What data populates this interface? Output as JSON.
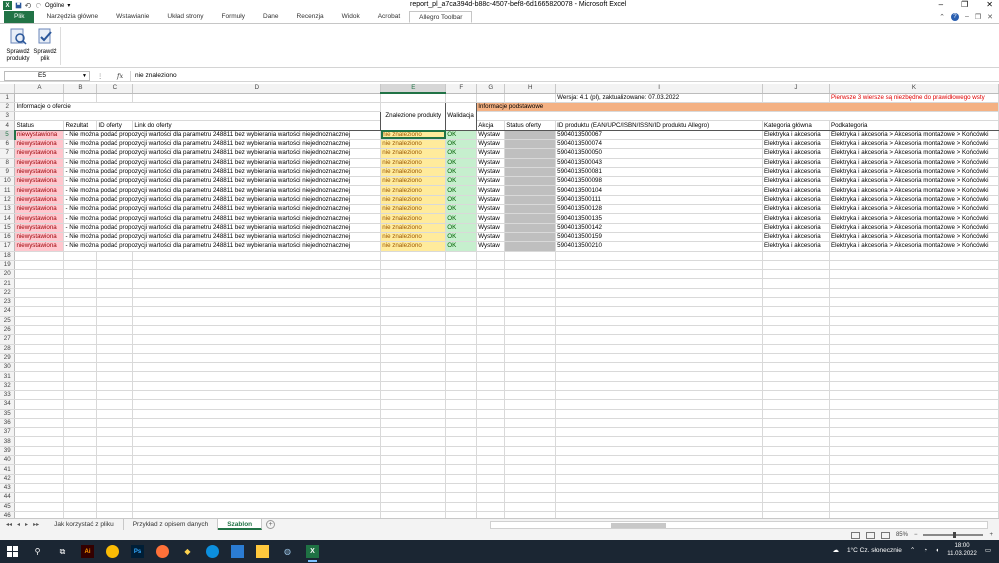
{
  "window": {
    "title": "report_pl_a7ca394d-b88c-4507-bef8-6d1665820078  -  Microsoft Excel",
    "logo": "X",
    "format_box": "Ogólne"
  },
  "ribbon_tabs": [
    "Plik",
    "Narzędzia główne",
    "Wstawianie",
    "Układ strony",
    "Formuły",
    "Dane",
    "Recenzja",
    "Widok",
    "Acrobat",
    "Allegro Toolbar"
  ],
  "ribbon": {
    "btn1": [
      "Sprawdź",
      "produkty"
    ],
    "btn2": [
      "Sprawdź",
      "plik"
    ]
  },
  "formula_bar": {
    "name_box": "E5",
    "fx": "fx",
    "formula": "nie znaleziono"
  },
  "columns": [
    "A",
    "B",
    "C",
    "D",
    "E",
    "F",
    "G",
    "H",
    "I",
    "J",
    "K"
  ],
  "sheet": {
    "version": "Wersja: 4.1 (pl), zaktualizowane: 07.03.2022",
    "note": "Pierwsze 3 wiersze są niezbędne do prawidłowego wsty",
    "info_offer": "Informacje o ofercie",
    "found_products": "Znalezione produkty",
    "validation": "Walidacja",
    "info_basic": "Informacje podstawowe",
    "headers": {
      "status": "Status",
      "result": "Rezultat",
      "offer_id": "ID oferty",
      "link": "Link do oferty",
      "action": "Akcja",
      "offer_status": "Status oferty",
      "product_id": "ID produktu (EAN/UPC/ISBN/ISSN/ID produktu Allegro)",
      "main_cat": "Kategoria główna",
      "subcat": "Podkategoria"
    },
    "rows": [
      {
        "status": "niewystawiona",
        "result": "- Nie można podać propozycji wartości dla parametru 248811 bez wybierania wartości niejednoznacznej",
        "found": "nie znaleziono",
        "valid": "OK",
        "action": "Wystaw",
        "ean": "5904013500067",
        "cat": "Elektryka i akcesoria",
        "sub": "Elektryka i akcesoria > Akcesoria montażowe > Końcówki"
      },
      {
        "status": "niewystawiona",
        "result": "- Nie można podać propozycji wartości dla parametru 248811 bez wybierania wartości niejednoznacznej",
        "found": "nie znaleziono",
        "valid": "OK",
        "action": "Wystaw",
        "ean": "5904013500074",
        "cat": "Elektryka i akcesoria",
        "sub": "Elektryka i akcesoria > Akcesoria montażowe > Końcówki"
      },
      {
        "status": "niewystawiona",
        "result": "- Nie można podać propozycji wartości dla parametru 248811 bez wybierania wartości niejednoznacznej",
        "found": "nie znaleziono",
        "valid": "OK",
        "action": "Wystaw",
        "ean": "5904013500050",
        "cat": "Elektryka i akcesoria",
        "sub": "Elektryka i akcesoria > Akcesoria montażowe > Końcówki"
      },
      {
        "status": "niewystawiona",
        "result": "- Nie można podać propozycji wartości dla parametru 248811 bez wybierania wartości niejednoznacznej",
        "found": "nie znaleziono",
        "valid": "OK",
        "action": "Wystaw",
        "ean": "5904013500043",
        "cat": "Elektryka i akcesoria",
        "sub": "Elektryka i akcesoria > Akcesoria montażowe > Końcówki"
      },
      {
        "status": "niewystawiona",
        "result": "- Nie można podać propozycji wartości dla parametru 248811 bez wybierania wartości niejednoznacznej",
        "found": "nie znaleziono",
        "valid": "OK",
        "action": "Wystaw",
        "ean": "5904013500081",
        "cat": "Elektryka i akcesoria",
        "sub": "Elektryka i akcesoria > Akcesoria montażowe > Końcówki"
      },
      {
        "status": "niewystawiona",
        "result": "- Nie można podać propozycji wartości dla parametru 248811 bez wybierania wartości niejednoznacznej",
        "found": "nie znaleziono",
        "valid": "OK",
        "action": "Wystaw",
        "ean": "5904013500098",
        "cat": "Elektryka i akcesoria",
        "sub": "Elektryka i akcesoria > Akcesoria montażowe > Końcówki"
      },
      {
        "status": "niewystawiona",
        "result": "- Nie można podać propozycji wartości dla parametru 248811 bez wybierania wartości niejednoznacznej",
        "found": "nie znaleziono",
        "valid": "OK",
        "action": "Wystaw",
        "ean": "5904013500104",
        "cat": "Elektryka i akcesoria",
        "sub": "Elektryka i akcesoria > Akcesoria montażowe > Końcówki"
      },
      {
        "status": "niewystawiona",
        "result": "- Nie można podać propozycji wartości dla parametru 248811 bez wybierania wartości niejednoznacznej",
        "found": "nie znaleziono",
        "valid": "OK",
        "action": "Wystaw",
        "ean": "5904013500111",
        "cat": "Elektryka i akcesoria",
        "sub": "Elektryka i akcesoria > Akcesoria montażowe > Końcówki"
      },
      {
        "status": "niewystawiona",
        "result": "- Nie można podać propozycji wartości dla parametru 248811 bez wybierania wartości niejednoznacznej",
        "found": "nie znaleziono",
        "valid": "OK",
        "action": "Wystaw",
        "ean": "5904013500128",
        "cat": "Elektryka i akcesoria",
        "sub": "Elektryka i akcesoria > Akcesoria montażowe > Końcówki"
      },
      {
        "status": "niewystawiona",
        "result": "- Nie można podać propozycji wartości dla parametru 248811 bez wybierania wartości niejednoznacznej",
        "found": "nie znaleziono",
        "valid": "OK",
        "action": "Wystaw",
        "ean": "5904013500135",
        "cat": "Elektryka i akcesoria",
        "sub": "Elektryka i akcesoria > Akcesoria montażowe > Końcówki"
      },
      {
        "status": "niewystawiona",
        "result": "- Nie można podać propozycji wartości dla parametru 248811 bez wybierania wartości niejednoznacznej",
        "found": "nie znaleziono",
        "valid": "OK",
        "action": "Wystaw",
        "ean": "5904013500142",
        "cat": "Elektryka i akcesoria",
        "sub": "Elektryka i akcesoria > Akcesoria montażowe > Końcówki"
      },
      {
        "status": "niewystawiona",
        "result": "- Nie można podać propozycji wartości dla parametru 248811 bez wybierania wartości niejednoznacznej",
        "found": "nie znaleziono",
        "valid": "OK",
        "action": "Wystaw",
        "ean": "5904013500159",
        "cat": "Elektryka i akcesoria",
        "sub": "Elektryka i akcesoria > Akcesoria montażowe > Końcówki"
      },
      {
        "status": "niewystawiona",
        "result": "- Nie można podać propozycji wartości dla parametru 248811 bez wybierania wartości niejednoznacznej",
        "found": "nie znaleziono",
        "valid": "OK",
        "action": "Wystaw",
        "ean": "5904013500210",
        "cat": "Elektryka i akcesoria",
        "sub": "Elektryka i akcesoria > Akcesoria montażowe > Końcówki"
      }
    ]
  },
  "sheet_tabs": [
    "Jak korzystać z pliku",
    "Przykład z opisem danych",
    "Szablon"
  ],
  "active_sheet_index": 2,
  "status_bar": {
    "zoom": "85%"
  },
  "taskbar": {
    "weather": "1°C  Cz. słonecznie",
    "time": "18:00",
    "date": "11.03.2022"
  },
  "colors": {
    "excel_green": "#217346",
    "orange_header": "#f4b183",
    "bad_fill": "#ffc7ce",
    "neutral_fill": "#ffeb9c",
    "good_fill": "#c6efce"
  }
}
